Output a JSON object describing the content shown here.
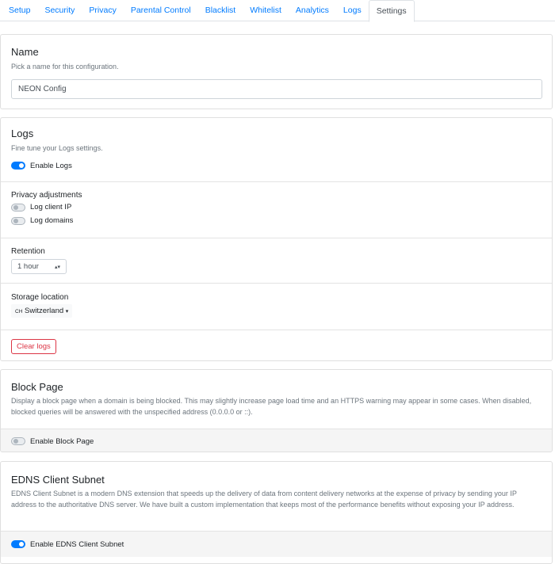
{
  "tabs": [
    {
      "label": "Setup"
    },
    {
      "label": "Security"
    },
    {
      "label": "Privacy"
    },
    {
      "label": "Parental Control"
    },
    {
      "label": "Blacklist"
    },
    {
      "label": "Whitelist"
    },
    {
      "label": "Analytics"
    },
    {
      "label": "Logs"
    },
    {
      "label": "Settings",
      "active": true
    }
  ],
  "name": {
    "title": "Name",
    "description": "Pick a name for this configuration.",
    "value": "NEON Config"
  },
  "logs": {
    "title": "Logs",
    "description": "Fine tune your Logs settings.",
    "enable_label": "Enable Logs",
    "enable_on": true,
    "privacy_title": "Privacy adjustments",
    "log_client_ip": "Log client IP",
    "log_domains": "Log domains",
    "retention_title": "Retention",
    "retention_value": "1 hour",
    "storage_title": "Storage location",
    "storage_flag": "CH",
    "storage_value": "Switzerland",
    "clear_label": "Clear logs"
  },
  "block_page": {
    "title": "Block Page",
    "description": "Display a block page when a domain is being blocked. This may slightly increase page load time and an HTTPS warning may appear in some cases. When disabled, blocked queries will be answered with the unspecified address (0.0.0.0 or ::).",
    "enable_label": "Enable Block Page",
    "enabled": false
  },
  "edns": {
    "title": "EDNS Client Subnet",
    "description": "EDNS Client Subnet is a modern DNS extension that speeds up the delivery of data from content delivery networks at the expense of privacy by sending your IP address to the authoritative DNS server. We have built a custom implementation that keeps most of the performance benefits without exposing your IP address.",
    "enable_label": "Enable EDNS Client Subnet",
    "enabled": true
  },
  "colors": {
    "accent": "#007bff",
    "danger": "#dc3545"
  }
}
